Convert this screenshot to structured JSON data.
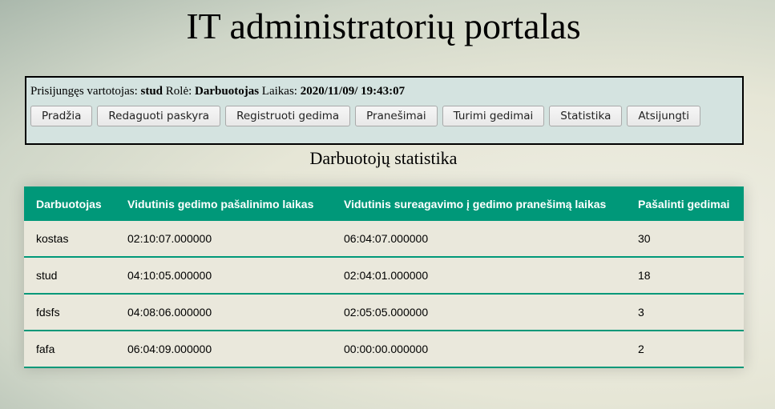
{
  "header": {
    "title": "IT administratorių portalas"
  },
  "user_panel": {
    "user_label": "Prisijungęs vartotojas:",
    "user_value": "stud",
    "role_label": "Rolė:",
    "role_value": "Darbuotojas",
    "time_label": "Laikas:",
    "time_value": "2020/11/09/ 19:43:07"
  },
  "nav": {
    "items": [
      {
        "label": "Pradžia"
      },
      {
        "label": "Redaguoti paskyra"
      },
      {
        "label": "Registruoti gedima"
      },
      {
        "label": "Pranešimai"
      },
      {
        "label": "Turimi gedimai"
      },
      {
        "label": "Statistika"
      },
      {
        "label": "Atsijungti"
      }
    ]
  },
  "section": {
    "title": "Darbuotojų statistika"
  },
  "table": {
    "headers": [
      "Darbuotojas",
      "Vidutinis gedimo pašalinimo laikas",
      "Vidutinis sureagavimo į gedimo pranešimą laikas",
      "Pašalinti gedimai"
    ],
    "rows": [
      [
        "kostas",
        "02:10:07.000000",
        "06:04:07.000000",
        "30"
      ],
      [
        "stud",
        "04:10:05.000000",
        "02:04:01.000000",
        "18"
      ],
      [
        "fdsfs",
        "04:08:06.000000",
        "02:05:05.000000",
        "3"
      ],
      [
        "fafa",
        "06:04:09.000000",
        "00:00:00.000000",
        "2"
      ]
    ]
  },
  "colors": {
    "accent": "#009879",
    "panel_background": "#d4e3e0"
  }
}
